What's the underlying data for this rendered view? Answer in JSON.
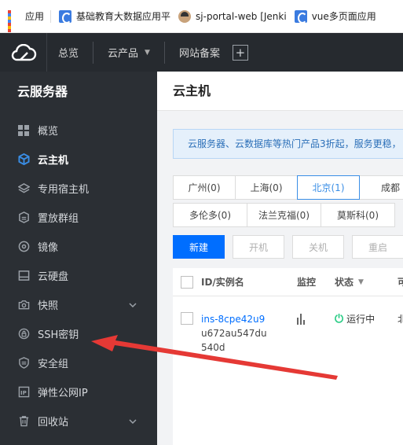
{
  "bookmarks": [
    {
      "label": "应用",
      "icon": "apps-grid-icon"
    },
    {
      "label": "基础教育大数据应用平",
      "icon": "bookmark-doc-icon"
    },
    {
      "label": "sj-portal-web [Jenki",
      "icon": "jenkins-icon"
    },
    {
      "label": "vue多页面应用",
      "icon": "bookmark-doc-icon"
    }
  ],
  "topnav": {
    "overview": "总览",
    "products": "云产品",
    "icp": "网站备案",
    "plus": "+"
  },
  "sidebar": {
    "title": "云服务器",
    "items": [
      {
        "label": "概览",
        "icon": "grid-icon"
      },
      {
        "label": "云主机",
        "icon": "cube-icon",
        "active": true
      },
      {
        "label": "专用宿主机",
        "icon": "layers-icon"
      },
      {
        "label": "置放群组",
        "icon": "group-icon"
      },
      {
        "label": "镜像",
        "icon": "disc-icon"
      },
      {
        "label": "云硬盘",
        "icon": "disk-icon"
      },
      {
        "label": "快照",
        "icon": "camera-icon",
        "expandable": true
      },
      {
        "label": "SSH密钥",
        "icon": "lock-icon"
      },
      {
        "label": "安全组",
        "icon": "shield-icon"
      },
      {
        "label": "弹性公网IP",
        "icon": "ip-icon"
      },
      {
        "label": "回收站",
        "icon": "trash-icon",
        "expandable": true
      }
    ]
  },
  "main": {
    "title": "云主机",
    "notice": "云服务器、云数据库等热门产品3折起，服务更稳，",
    "regions_row1": [
      {
        "label": "广州(0)"
      },
      {
        "label": "上海(0)"
      },
      {
        "label": "北京(1)",
        "selected": true
      },
      {
        "label": "成都"
      }
    ],
    "regions_row2": [
      {
        "label": "多伦多(0)"
      },
      {
        "label": "法兰克福(0)"
      },
      {
        "label": "莫斯科(0)"
      }
    ],
    "actions": {
      "create": "新建",
      "start": "开机",
      "stop": "关机",
      "restart": "重启"
    },
    "table": {
      "headers": {
        "id": "ID/实例名",
        "monitor": "监控",
        "status": "状态",
        "cut": "可"
      },
      "rows": [
        {
          "id": "ins-8cpe42u9",
          "name": "u672au547du540d",
          "status": "运行中",
          "cut": "北"
        }
      ]
    }
  },
  "colors": {
    "topnav_bg": "#262a2f",
    "sidebar_bg": "#2b2f34",
    "primary": "#006eff",
    "running": "#29cc85",
    "arrow": "#e53935"
  }
}
